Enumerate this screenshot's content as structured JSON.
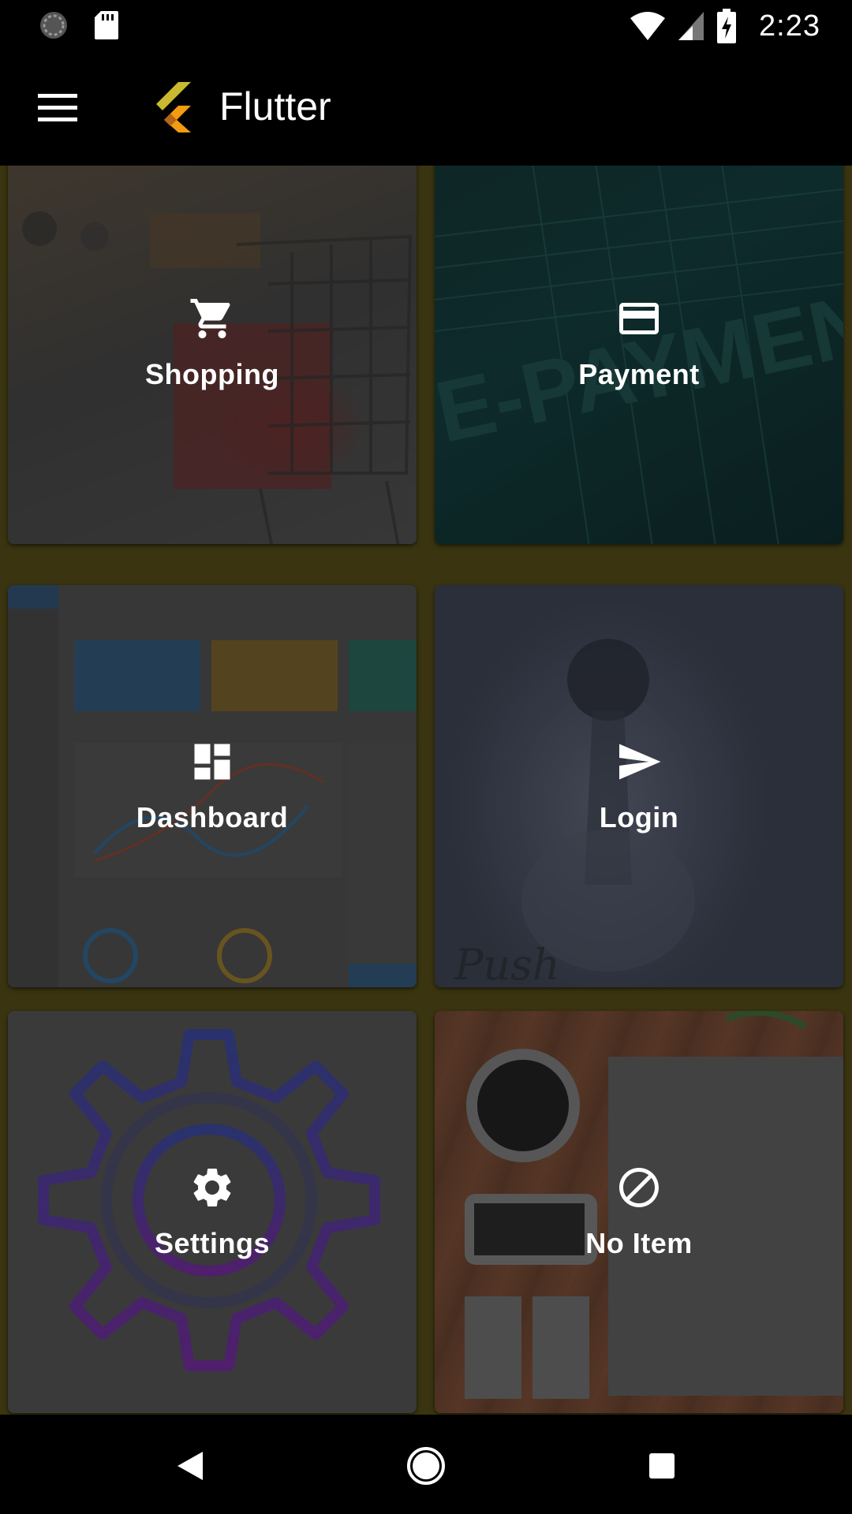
{
  "status_bar": {
    "time": "2:23",
    "icons": [
      "sync-icon",
      "sd-card-icon",
      "wifi-icon",
      "signal-icon",
      "battery-charging-icon"
    ]
  },
  "app_bar": {
    "title": "Flutter",
    "menu_icon": "hamburger-menu-icon",
    "logo": "flutter-logo"
  },
  "tiles": [
    {
      "label": "Shopping",
      "icon": "shopping-cart-icon"
    },
    {
      "label": "Payment",
      "icon": "credit-card-icon"
    },
    {
      "label": "Dashboard",
      "icon": "dashboard-icon"
    },
    {
      "label": "Login",
      "icon": "send-icon"
    },
    {
      "label": "Settings",
      "icon": "gear-icon"
    },
    {
      "label": "No Item",
      "icon": "block-icon"
    }
  ],
  "nav_bar": {
    "buttons": [
      "back-icon",
      "home-icon",
      "recents-icon"
    ]
  },
  "colors": {
    "background": "#000000",
    "grid_background": "#3a3510",
    "accent": "#ffffff"
  }
}
